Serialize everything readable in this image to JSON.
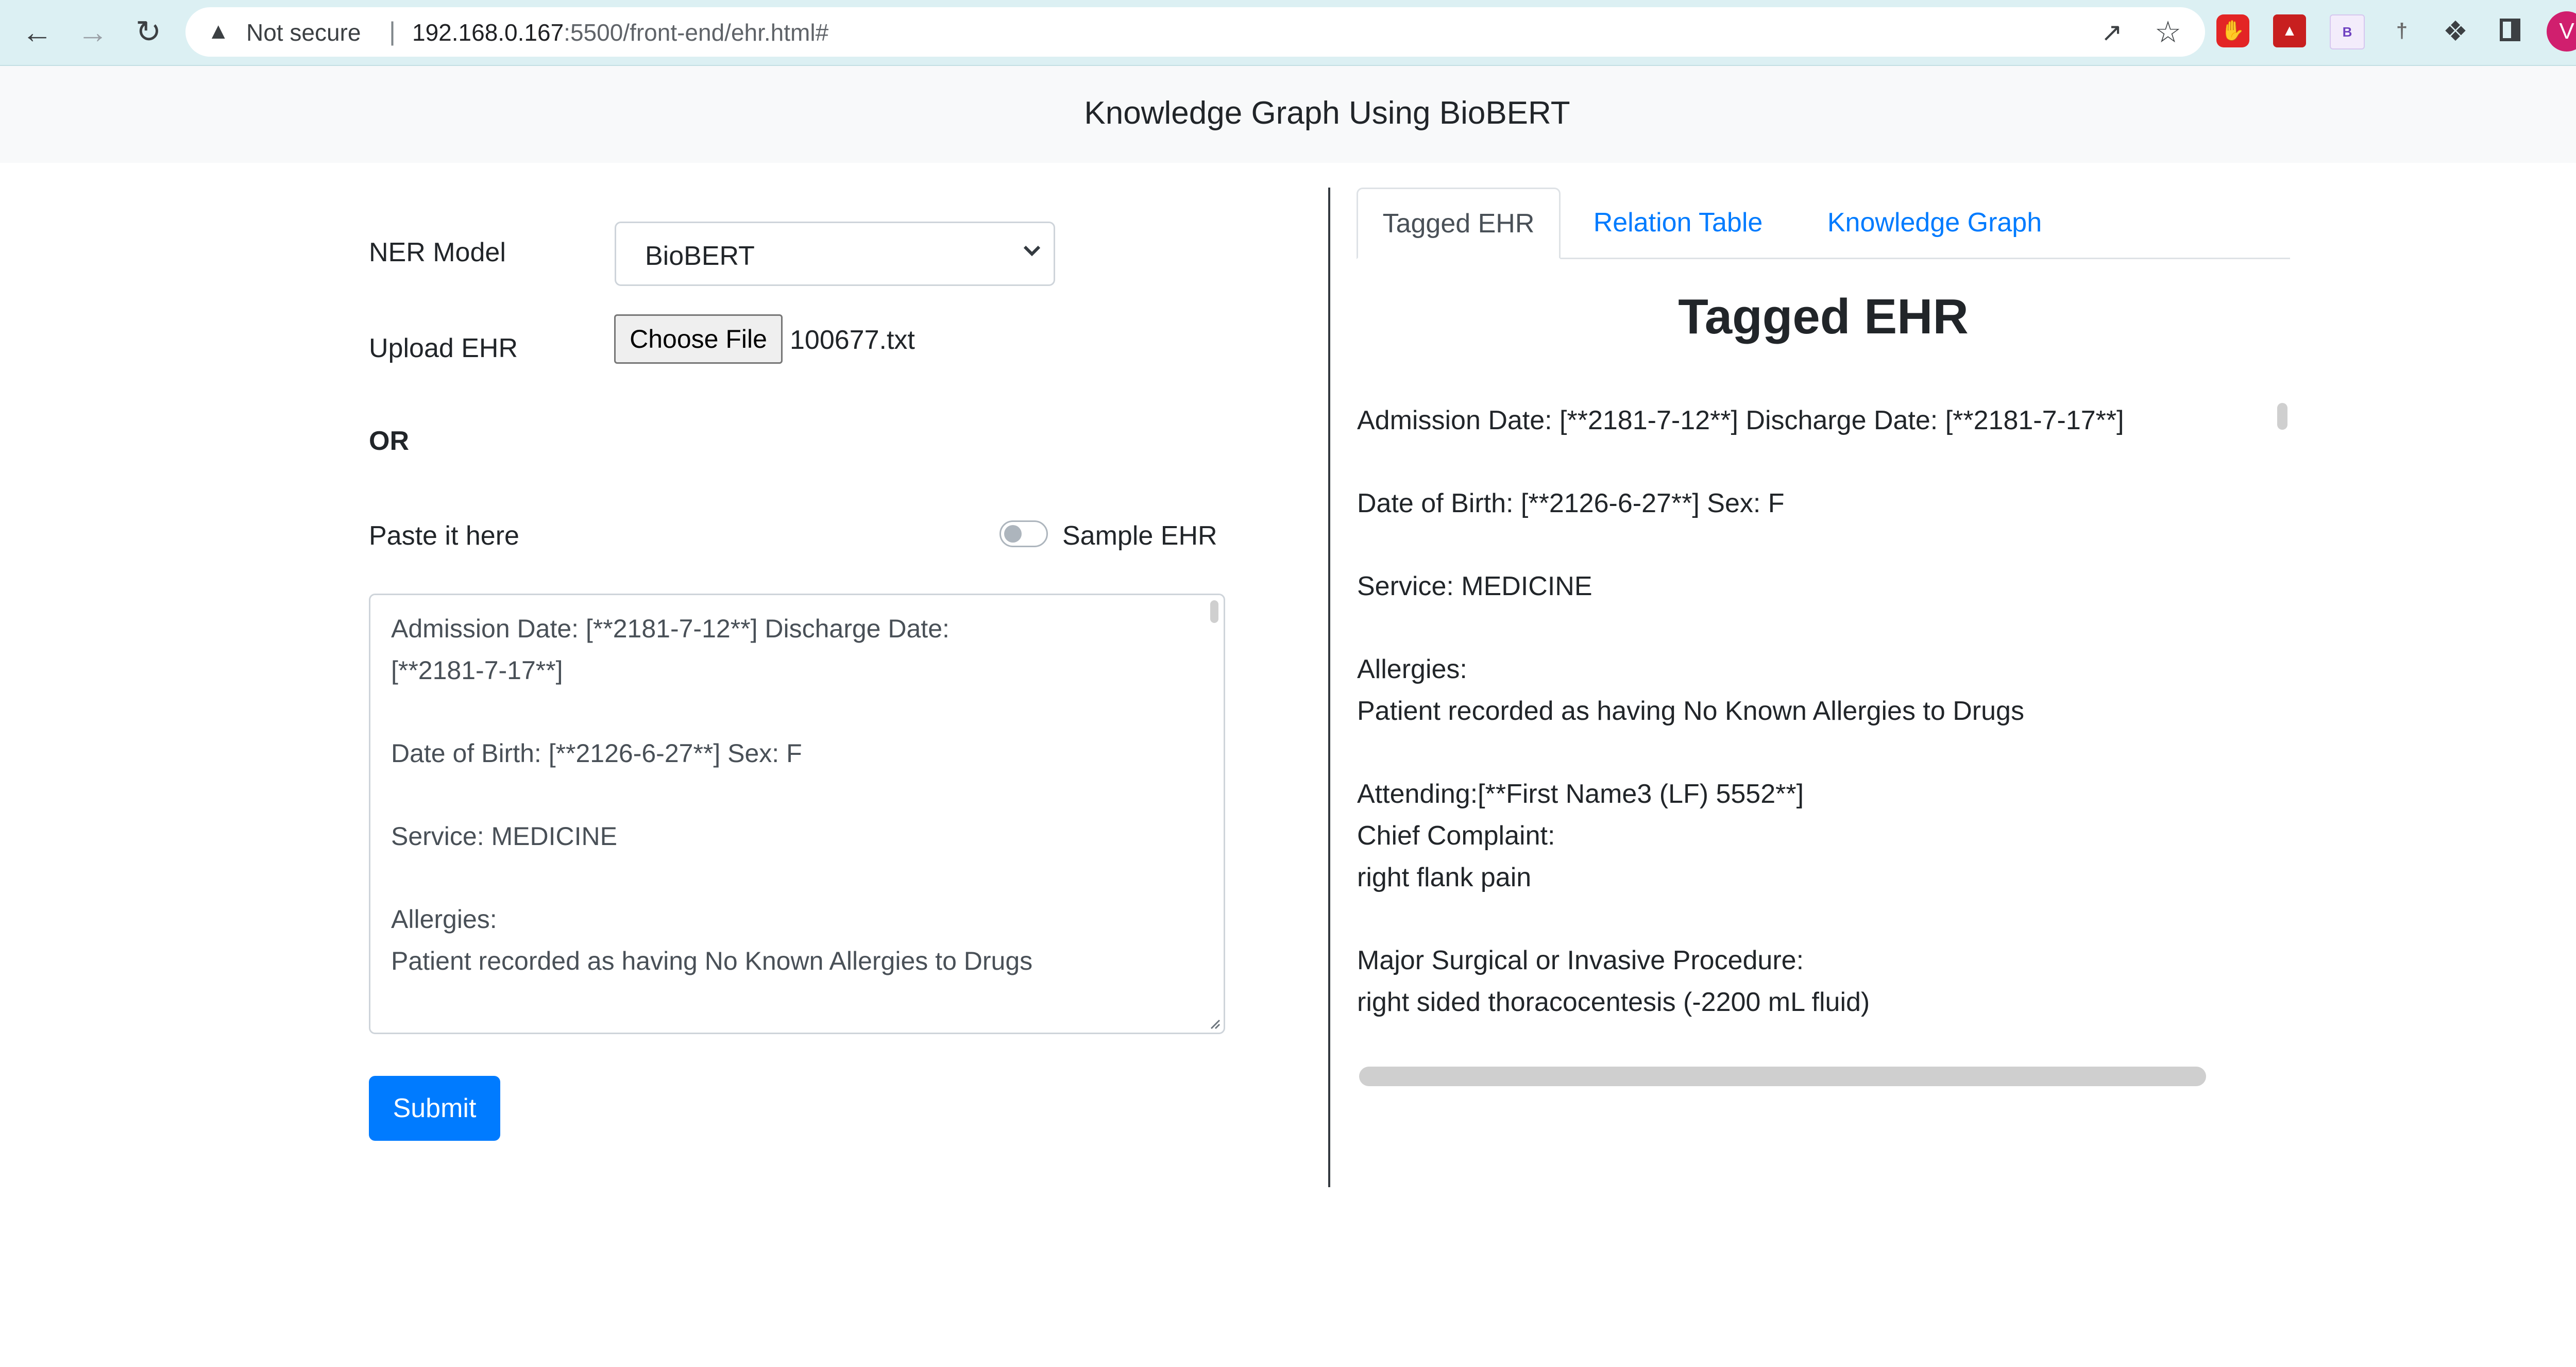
{
  "browser": {
    "security_label": "Not secure",
    "separator": "|",
    "url_host": "192.168.0.167",
    "url_rest": ":5500/front-end/ehr.html#",
    "profile_initial": "V",
    "ext_b_letter": "B"
  },
  "navbar": {
    "title": "Knowledge Graph Using BioBERT"
  },
  "form": {
    "ner_label": "NER Model",
    "ner_selected": "BioBERT",
    "upload_label": "Upload EHR",
    "choose_file_label": "Choose File",
    "file_name": "100677.txt",
    "or_label": "OR",
    "paste_label": "Paste it here",
    "sample_label": "Sample EHR",
    "sample_on": false,
    "textarea_lines": [
      "Admission Date:  [**2181-7-12**]              Discharge Date:",
      "[**2181-7-17**]",
      "Date of Birth:  [**2126-6-27**]              Sex:   F",
      "Service: MEDICINE",
      "Allergies:",
      "Patient recorded as having No Known Allergies to Drugs"
    ],
    "submit_label": "Submit"
  },
  "tabs": [
    {
      "label": "Tagged EHR",
      "active": true
    },
    {
      "label": "Relation Table",
      "active": false
    },
    {
      "label": "Knowledge Graph",
      "active": false
    }
  ],
  "tagged": {
    "heading": "Tagged EHR",
    "lines": [
      "Admission Date: [**2181-7-12**] Discharge Date: [**2181-7-17**]",
      "Date of Birth: [**2126-6-27**] Sex: F",
      "Service: MEDICINE",
      "Allergies:",
      "Patient recorded as having No Known Allergies to Drugs",
      "Attending:[**First Name3 (LF) 5552**]",
      "Chief Complaint:",
      "right flank pain",
      "Major Surgical or Invasive Procedure:",
      "right sided thoracocentesis (-2200 mL fluid)"
    ]
  },
  "colors": {
    "primary": "#007bff",
    "chrome_bg": "#dcf0f3",
    "navbar_bg": "#f8f9fa"
  }
}
